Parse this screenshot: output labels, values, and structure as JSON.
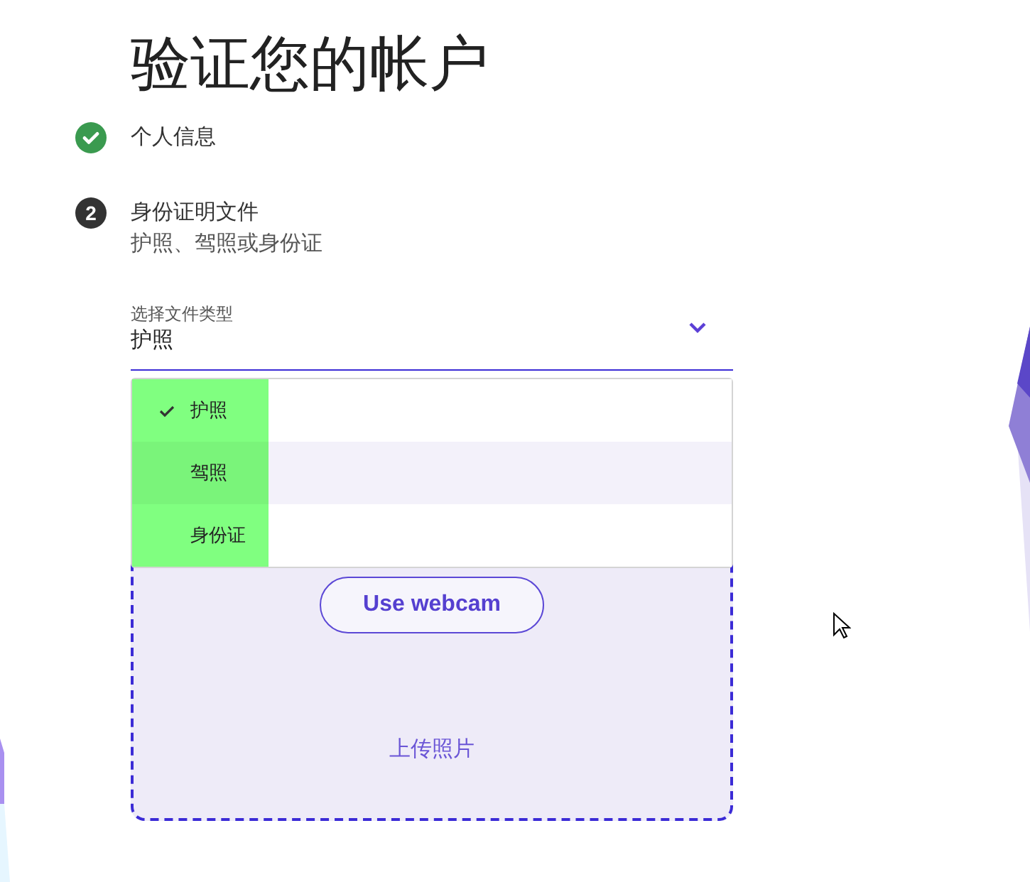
{
  "title": "验证您的帐户",
  "steps": [
    {
      "kind": "done",
      "label": "个人信息"
    },
    {
      "kind": "current",
      "marker": "2",
      "label": "身份证明文件",
      "sublabel": "护照、驾照或身份证"
    }
  ],
  "document_type": {
    "label": "选择文件类型",
    "value": "护照",
    "expanded": true,
    "options": [
      {
        "label": "护照",
        "selected": true,
        "hovered": false
      },
      {
        "label": "驾照",
        "selected": false,
        "hovered": true
      },
      {
        "label": "身份证",
        "selected": false,
        "hovered": false
      }
    ]
  },
  "upload": {
    "button": "Use webcam",
    "link": "上传照片"
  }
}
